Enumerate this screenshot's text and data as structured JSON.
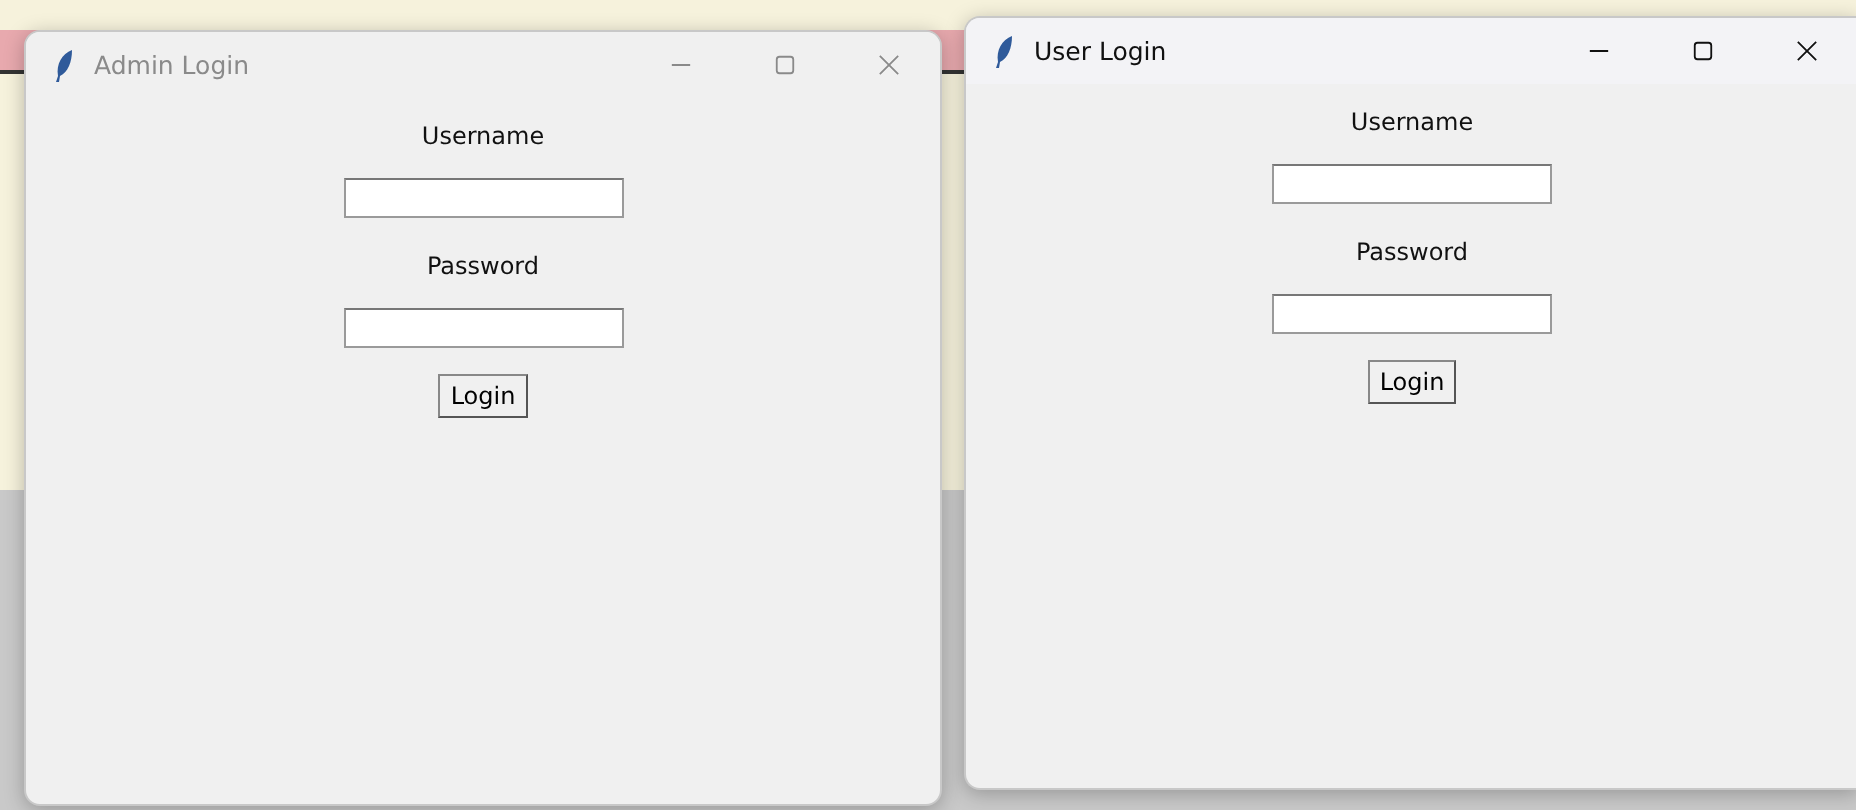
{
  "windows": [
    {
      "title": "Admin Login",
      "active": false,
      "fields": [
        {
          "label": "Username"
        },
        {
          "label": "Password"
        }
      ],
      "button": "Login"
    },
    {
      "title": "User Login",
      "active": true,
      "fields": [
        {
          "label": "Username"
        },
        {
          "label": "Password"
        }
      ],
      "button": "Login"
    }
  ]
}
